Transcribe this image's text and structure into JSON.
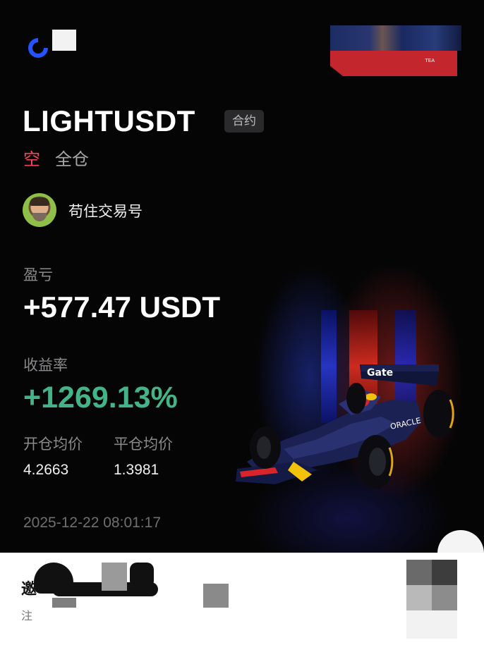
{
  "header": {
    "logo_icon": "gate-logo-icon"
  },
  "banner": {
    "tag": "TEA"
  },
  "position": {
    "symbol": "LIGHTUSDT",
    "type_badge": "合约",
    "side": "空",
    "margin_mode": "全仓"
  },
  "trader": {
    "name": "苟住交易号"
  },
  "pnl": {
    "label": "盈亏",
    "value": "+577.47 USDT"
  },
  "roi": {
    "label": "收益率",
    "value": "+1269.13%"
  },
  "prices": {
    "open_label": "开仓均价",
    "open_value": "4.2663",
    "close_label": "平仓均价",
    "close_value": "1.3981"
  },
  "timestamp": "2025-12-22 08:01:17",
  "car_livery": {
    "sponsor1": "Gate",
    "sponsor2": "ORACLE"
  },
  "footer": {
    "title": "邀",
    "subtitle": "注"
  },
  "colors": {
    "short": "#f2485c",
    "profit": "#44b488",
    "background": "#050506"
  }
}
